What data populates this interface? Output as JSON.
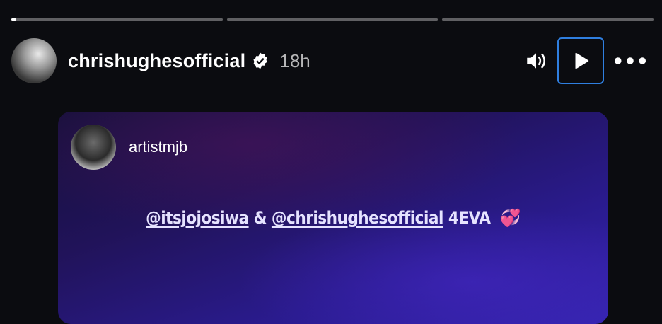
{
  "progress": {
    "segments": [
      0.02,
      0,
      0
    ]
  },
  "header": {
    "username": "chrishughesofficial",
    "time": "18h",
    "icons": [
      "verified-icon",
      "volume-icon",
      "play-icon",
      "more-icon"
    ]
  },
  "post": {
    "username": "artistmjb",
    "caption": {
      "mention1": "@itsjojosiwa",
      "amp": "&",
      "mention2": "@chrishughesofficial",
      "text": "4EVA",
      "emoji": "💞"
    }
  },
  "colors": {
    "accent": "#2f7fe0",
    "background": "#0b0c10"
  }
}
